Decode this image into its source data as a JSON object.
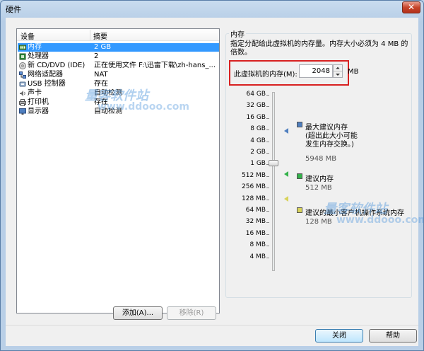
{
  "window": {
    "title": "硬件",
    "close_glyph": "✕"
  },
  "device_list": {
    "columns": [
      "设备",
      "摘要"
    ],
    "items": [
      {
        "label": "内存",
        "summary": "2 GB",
        "icon": "memory-icon",
        "selected": true
      },
      {
        "label": "处理器",
        "summary": "2",
        "icon": "processor-icon"
      },
      {
        "label": "新 CD/DVD (IDE)",
        "summary": "正在使用文件 F:\\迅雷下载\\zh-hans_...",
        "icon": "cd-dvd-icon"
      },
      {
        "label": "网络适配器",
        "summary": "NAT",
        "icon": "network-adapter-icon"
      },
      {
        "label": "USB 控制器",
        "summary": "存在",
        "icon": "usb-controller-icon"
      },
      {
        "label": "声卡",
        "summary": "自动检测",
        "icon": "sound-card-icon"
      },
      {
        "label": "打印机",
        "summary": "存在",
        "icon": "printer-icon"
      },
      {
        "label": "显示器",
        "summary": "自动检测",
        "icon": "display-icon"
      }
    ]
  },
  "buttons": {
    "add": "添加(A)...",
    "remove": "移除(R)",
    "close": "关闭",
    "help": "帮助"
  },
  "memory": {
    "group_title": "内存",
    "description": "指定分配给此虚拟机的内存量。内存大小必须为 4 MB 的倍数。",
    "label": "此虚拟机的内存(M):",
    "value": "2048",
    "unit": "MB",
    "scale_labels": [
      "64 GB",
      "32 GB",
      "16 GB",
      "8 GB",
      "4 GB",
      "2 GB",
      "1 GB",
      "512 MB",
      "256 MB",
      "128 MB",
      "64 MB",
      "32 MB",
      "16 MB",
      "8 MB",
      "4 MB"
    ],
    "legend": [
      {
        "title": "最大建议内存",
        "note": "(超出此大小可能\n发生内存交换。)",
        "value": "5948 MB",
        "color": "#4f7fbf"
      },
      {
        "title": "建议内存",
        "value": "512 MB",
        "color": "#33b24a"
      },
      {
        "title": "建议的最小客户机操作系统内存",
        "value": "128 MB",
        "color": "#d8d35a"
      }
    ]
  },
  "watermark": {
    "text": "量客软件站",
    "url": "www.ddooo.com"
  }
}
